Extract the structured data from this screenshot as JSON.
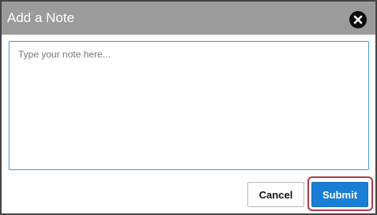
{
  "dialog": {
    "title": "Add a Note",
    "close_icon": "close-icon",
    "note": {
      "placeholder": "Type your note here...",
      "value": ""
    },
    "cancel_label": "Cancel",
    "submit_label": "Submit"
  },
  "colors": {
    "header_bg": "#9b9b9b",
    "primary": "#1a7fd4",
    "focus_highlight": "#b23a48",
    "input_border": "#3d9ad6"
  }
}
